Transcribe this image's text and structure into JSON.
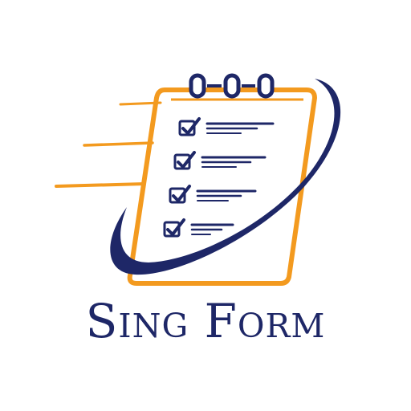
{
  "brand": {
    "name": "Sing Form"
  },
  "icon": {
    "name": "checklist-clipboard-icon",
    "items": 4
  },
  "colors": {
    "navy": "#1e2767",
    "orange": "#f39a1f",
    "background": "#ffffff"
  }
}
